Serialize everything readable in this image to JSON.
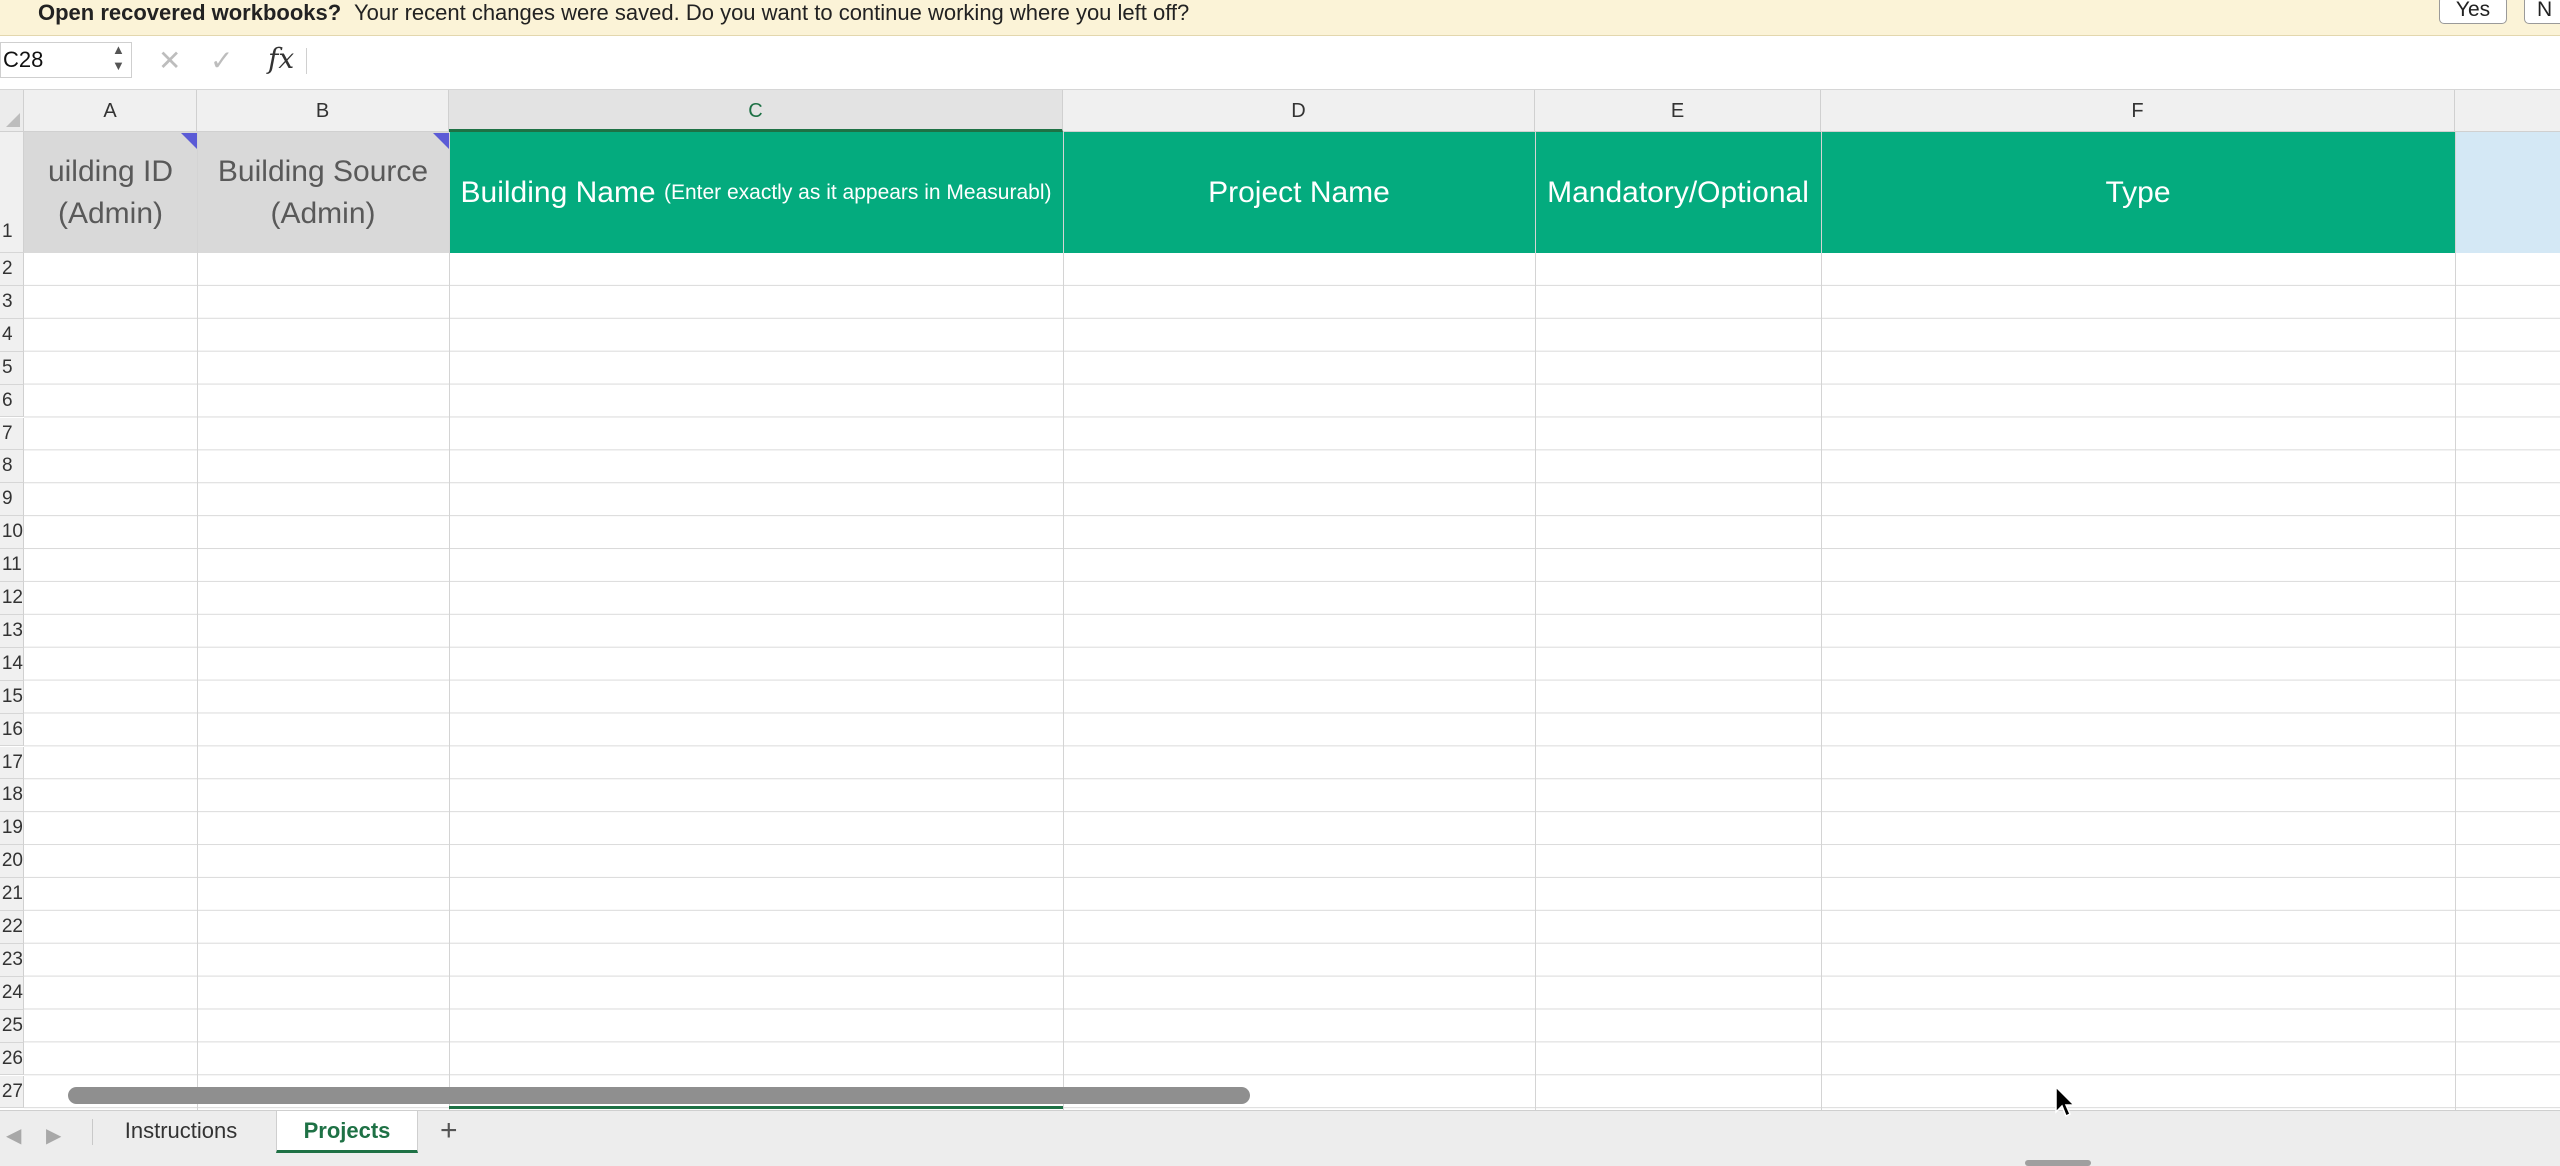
{
  "infobar": {
    "title": "Open recovered workbooks?",
    "message": "Your recent changes were saved. Do you want to continue working where you left off?",
    "yes_label": "Yes",
    "no_label": "N"
  },
  "formula_bar": {
    "name_box": "C28",
    "cancel_icon": "close-icon",
    "confirm_icon": "checkmark-icon",
    "fx_label": "fx",
    "formula": ""
  },
  "columns": [
    "A",
    "B",
    "C",
    "D",
    "E",
    "F"
  ],
  "selected_column": "C",
  "rows": [
    "1",
    "2",
    "3",
    "4",
    "5",
    "6",
    "7",
    "8",
    "9",
    "10",
    "11",
    "12",
    "13",
    "14",
    "15",
    "16",
    "17",
    "18",
    "19",
    "20",
    "21",
    "22",
    "23",
    "24",
    "25",
    "26",
    "27"
  ],
  "header_row": {
    "a_line1": "uilding ID",
    "a_line2": "(Admin)",
    "b_line1": "Building Source",
    "b_line2": "(Admin)",
    "c_main": "Building Name",
    "c_note": "(Enter exactly as it appears in Measurabl)",
    "d": "Project Name",
    "e": "Mandatory/Optional",
    "f": "Type"
  },
  "sheet_tabs": {
    "tabs": [
      "Instructions",
      "Projects"
    ],
    "active": "Projects",
    "add_label": "+"
  },
  "colors": {
    "header_green": "#04ab7e",
    "header_grey": "#d9d9d9",
    "accent_green": "#1e7145",
    "infobar_bg": "#fbf3d7"
  }
}
